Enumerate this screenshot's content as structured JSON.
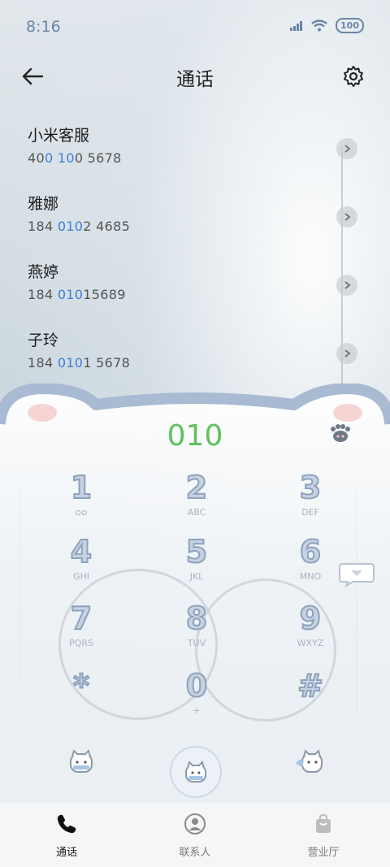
{
  "status_bar": {
    "time": "8:16",
    "battery": "100"
  },
  "header": {
    "title": "通话"
  },
  "contacts": [
    {
      "name": "小米客服",
      "num_pre": "40",
      "num_a": "0",
      "num_mid": " ",
      "num_b": "10",
      "num_post": "0 5678"
    },
    {
      "name": "雅娜",
      "num_pre": "184 ",
      "num_a": "010",
      "num_mid": "",
      "num_b": "",
      "num_post": "2 4685"
    },
    {
      "name": "燕婷",
      "num_pre": "184 ",
      "num_a": "010",
      "num_mid": "",
      "num_b": "",
      "num_post": "15689"
    },
    {
      "name": "子玲",
      "num_pre": "184 ",
      "num_a": "010",
      "num_mid": "",
      "num_b": "",
      "num_post": "1 5678"
    }
  ],
  "dialpad": {
    "input": "010",
    "keys": [
      {
        "num": "1",
        "letters": "ᴑᴑ"
      },
      {
        "num": "2",
        "letters": "ABC"
      },
      {
        "num": "3",
        "letters": "DEF"
      },
      {
        "num": "4",
        "letters": "GHI"
      },
      {
        "num": "5",
        "letters": "JKL"
      },
      {
        "num": "6",
        "letters": "MNO"
      },
      {
        "num": "7",
        "letters": "PQRS"
      },
      {
        "num": "8",
        "letters": "TUV"
      },
      {
        "num": "9",
        "letters": "WXYZ"
      },
      {
        "num": "*",
        "letters": ""
      },
      {
        "num": "0",
        "letters": "+"
      },
      {
        "num": "#",
        "letters": ""
      }
    ]
  },
  "tabs": [
    {
      "label": "通话",
      "icon": "phone-icon",
      "color": "#1a1a1a"
    },
    {
      "label": "联系人",
      "icon": "person-icon",
      "color": "#7d7d7d"
    },
    {
      "label": "营业厅",
      "icon": "bag-icon",
      "color": "#7d7d7d"
    }
  ],
  "colors": {
    "accent_blue": "#3d7fd6",
    "digits_green": "#5ec15e",
    "cat_blue": "#a9bad3"
  }
}
